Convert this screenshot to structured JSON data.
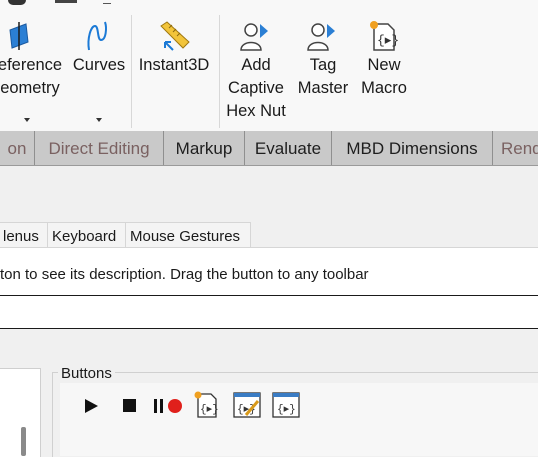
{
  "ribbon": {
    "reference_geometry_line1": "eference",
    "reference_geometry_line2": "eometry",
    "curves_label": "Curves",
    "instant3d_label": "Instant3D",
    "add_captive_line1": "Add",
    "add_captive_line2": "Captive",
    "add_captive_line3": "Hex Nut",
    "tag_master_line1": "Tag",
    "tag_master_line2": "Master",
    "new_macro_line1": "New",
    "new_macro_line2": "Macro"
  },
  "tabs": [
    {
      "label": "on"
    },
    {
      "label": "Direct Editing"
    },
    {
      "label": "Markup"
    },
    {
      "label": "Evaluate"
    },
    {
      "label": "MBD Dimensions"
    },
    {
      "label": "Rend"
    }
  ],
  "dialog": {
    "tabs": [
      {
        "label": "lenus"
      },
      {
        "label": "Keyboard"
      },
      {
        "label": "Mouse Gestures"
      }
    ],
    "description": "ton to see its description. Drag the button to any toolbar",
    "buttons_group_label": "Buttons"
  },
  "colors": {
    "accent_blue": "#1c7ad6",
    "record_red": "#e0201b",
    "macro_gold": "#f0a020"
  }
}
